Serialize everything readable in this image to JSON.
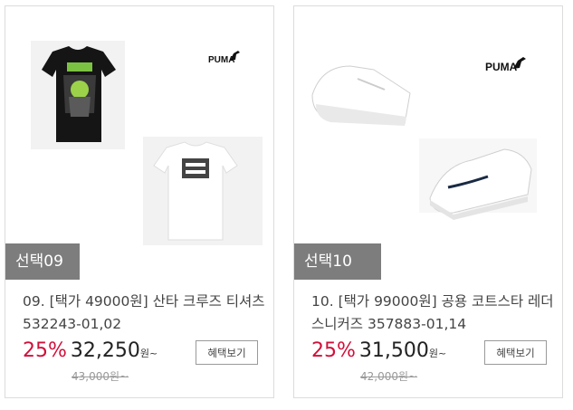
{
  "products": [
    {
      "badge": "선택09",
      "title": "09. [택가 49000원] 산타 크루즈 티셔츠 532243-01,02",
      "discount": "25%",
      "price": "32,250",
      "price_unit": "원~",
      "original_price": "43,000원~",
      "benefit_label": "혜택보기",
      "brand": "PUMA"
    },
    {
      "badge": "선택10",
      "title": "10. [택가 99000원] 공용 코트스타 레더 스니커즈 357883-01,14",
      "discount": "25%",
      "price": "31,500",
      "price_unit": "원~",
      "original_price": "42,000원~",
      "benefit_label": "혜택보기",
      "brand": "PUMA"
    }
  ],
  "colors": {
    "discount": "#d0103a",
    "badge_bg": "#7d7d7d"
  }
}
